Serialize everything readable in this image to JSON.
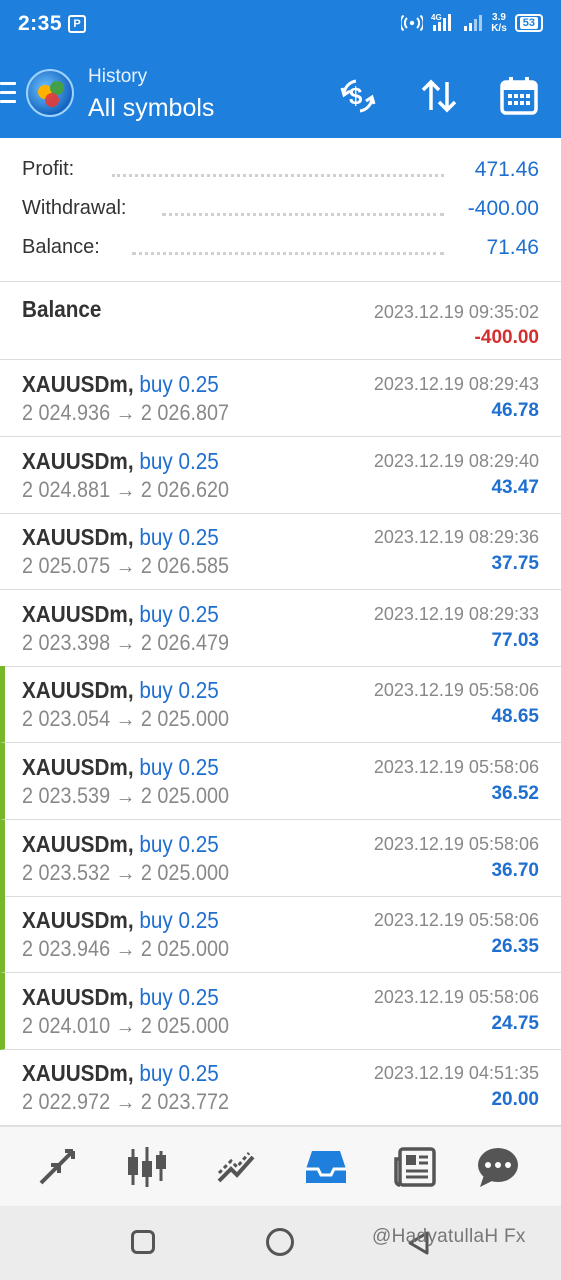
{
  "status_bar": {
    "time": "2:35",
    "notification_icon": "pk-icon",
    "network": "4G",
    "speed_value": "3.9",
    "speed_unit": "K/s",
    "battery": "53"
  },
  "app_bar": {
    "subtitle": "History",
    "title": "All symbols",
    "icons": [
      "menu-icon",
      "mt-logo-icon",
      "dollar-refresh-icon",
      "sort-icon",
      "calendar-icon"
    ]
  },
  "summary": [
    {
      "label": "Profit:",
      "value": "471.46"
    },
    {
      "label": "Withdrawal:",
      "value": "-400.00"
    },
    {
      "label": "Balance:",
      "value": "71.46"
    }
  ],
  "balance_entry": {
    "title": "Balance",
    "time": "2023.12.19 09:35:02",
    "amount": "-400.00"
  },
  "deals": [
    {
      "symbol": "XAUUSDm,",
      "side": "buy 0.25",
      "open": "2 024.936",
      "arrow": "→",
      "close": "2 026.807",
      "time": "2023.12.19 08:29:43",
      "profit": "46.78",
      "marked": false
    },
    {
      "symbol": "XAUUSDm,",
      "side": "buy 0.25",
      "open": "2 024.881",
      "arrow": "→",
      "close": "2 026.620",
      "time": "2023.12.19 08:29:40",
      "profit": "43.47",
      "marked": false
    },
    {
      "symbol": "XAUUSDm,",
      "side": "buy 0.25",
      "open": "2 025.075",
      "arrow": "→",
      "close": "2 026.585",
      "time": "2023.12.19 08:29:36",
      "profit": "37.75",
      "marked": false
    },
    {
      "symbol": "XAUUSDm,",
      "side": "buy 0.25",
      "open": "2 023.398",
      "arrow": "→",
      "close": "2 026.479",
      "time": "2023.12.19 08:29:33",
      "profit": "77.03",
      "marked": false
    },
    {
      "symbol": "XAUUSDm,",
      "side": "buy 0.25",
      "open": "2 023.054",
      "arrow": "→",
      "close": "2 025.000",
      "time": "2023.12.19 05:58:06",
      "profit": "48.65",
      "marked": true
    },
    {
      "symbol": "XAUUSDm,",
      "side": "buy 0.25",
      "open": "2 023.539",
      "arrow": "→",
      "close": "2 025.000",
      "time": "2023.12.19 05:58:06",
      "profit": "36.52",
      "marked": true
    },
    {
      "symbol": "XAUUSDm,",
      "side": "buy 0.25",
      "open": "2 023.532",
      "arrow": "→",
      "close": "2 025.000",
      "time": "2023.12.19 05:58:06",
      "profit": "36.70",
      "marked": true
    },
    {
      "symbol": "XAUUSDm,",
      "side": "buy 0.25",
      "open": "2 023.946",
      "arrow": "→",
      "close": "2 025.000",
      "time": "2023.12.19 05:58:06",
      "profit": "26.35",
      "marked": true
    },
    {
      "symbol": "XAUUSDm,",
      "side": "buy 0.25",
      "open": "2 024.010",
      "arrow": "→",
      "close": "2 025.000",
      "time": "2023.12.19 05:58:06",
      "profit": "24.75",
      "marked": true
    },
    {
      "symbol": "XAUUSDm,",
      "side": "buy 0.25",
      "open": "2 022.972",
      "arrow": "→",
      "close": "2 023.772",
      "time": "2023.12.19 04:51:35",
      "profit": "20.00",
      "marked": false
    }
  ],
  "bottom_nav": {
    "items": [
      "quotes-icon",
      "chart-icon",
      "trade-icon",
      "history-icon",
      "news-icon",
      "chat-icon"
    ],
    "active_index": 3,
    "active_color": "#1e7fdc",
    "inactive_color": "#555555"
  },
  "system_nav": {
    "watermark": "@HadyatullaH Fx"
  },
  "colors": {
    "brand": "#1e7fdc",
    "positive": "#1f6fd0",
    "negative": "#d32f2f",
    "marker": "#76b82a"
  }
}
